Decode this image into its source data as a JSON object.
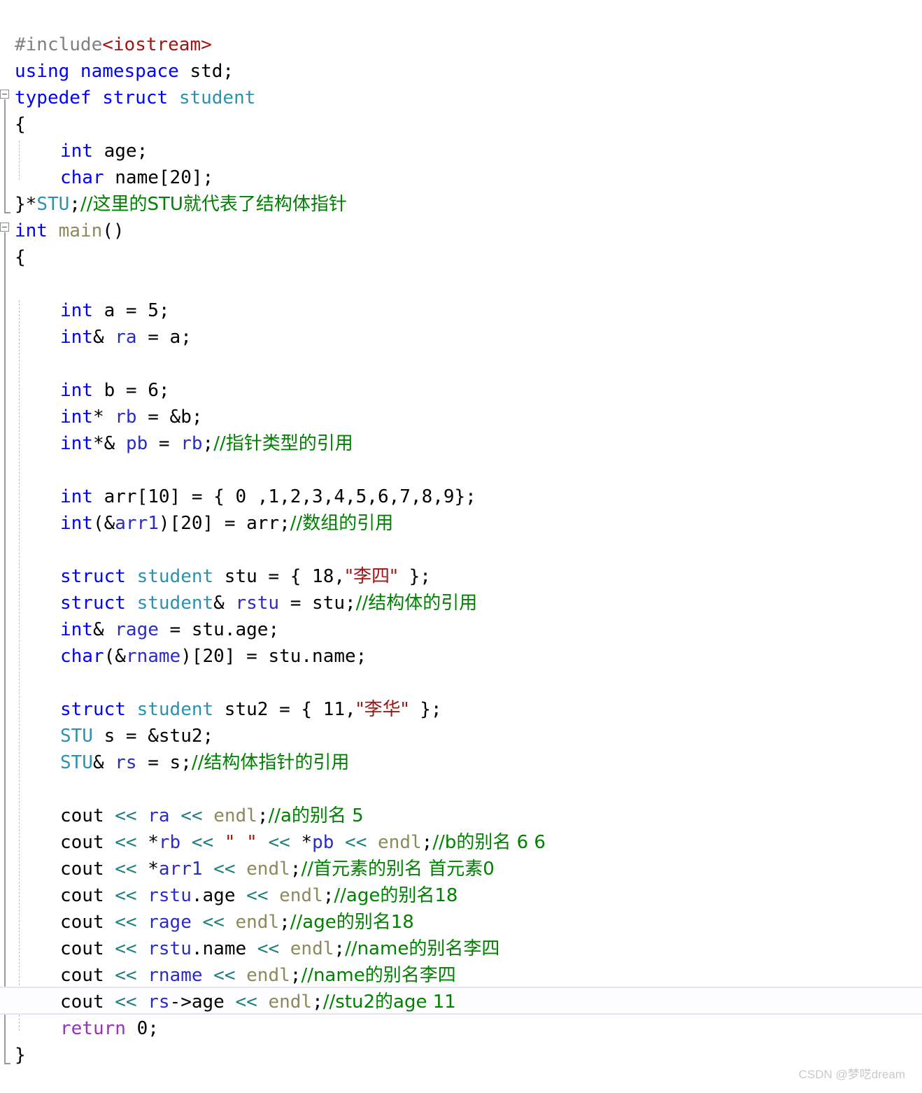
{
  "editor": {
    "language": "C++",
    "background": "#ffffff",
    "line_height": 38,
    "font_size": 26,
    "current_line_number": 35,
    "current_line_highlight_color": "#e4e4f2"
  },
  "palette": {
    "preprocessor": "#808080",
    "header": "#a31515",
    "keyword": "#0000ff",
    "user_type": "#2b91af",
    "identifier": "#000000",
    "variable": "#2b2bc8",
    "function": "#8c8a5a",
    "stream_operator": "#217f7f",
    "string": "#a31515",
    "comment": "#008000",
    "return_keyword": "#9b30c0",
    "fold_marker": "#8c8c8c",
    "indent_guide": "#bdbdbd",
    "scope_bar": "#9a9a9a"
  },
  "gutter": {
    "fold_markers": [
      {
        "name": "fold-typedef-struct-student",
        "state": "expanded",
        "glyph": "minus-square"
      },
      {
        "name": "fold-int-main",
        "state": "expanded",
        "glyph": "minus-square"
      }
    ]
  },
  "code": {
    "lines": [
      {
        "n": 1,
        "indent": 0,
        "segments": [
          {
            "t": "#include",
            "c": "pre"
          },
          {
            "t": "<iostream>",
            "c": "header"
          }
        ]
      },
      {
        "n": 2,
        "indent": 0,
        "segments": [
          {
            "t": "using namespace",
            "c": "kw"
          },
          {
            "t": " std;",
            "c": "plain"
          }
        ]
      },
      {
        "n": 3,
        "indent": 0,
        "segments": [
          {
            "t": "typedef struct",
            "c": "kw"
          },
          {
            "t": " ",
            "c": "plain"
          },
          {
            "t": "student",
            "c": "type"
          }
        ]
      },
      {
        "n": 4,
        "indent": 0,
        "segments": [
          {
            "t": "{",
            "c": "plain"
          }
        ]
      },
      {
        "n": 5,
        "indent": 1,
        "segments": [
          {
            "t": "int",
            "c": "kw"
          },
          {
            "t": " age;",
            "c": "plain"
          }
        ]
      },
      {
        "n": 6,
        "indent": 1,
        "segments": [
          {
            "t": "char",
            "c": "kw"
          },
          {
            "t": " name[20];",
            "c": "plain"
          }
        ]
      },
      {
        "n": 7,
        "indent": 0,
        "segments": [
          {
            "t": "}*",
            "c": "plain"
          },
          {
            "t": "STU",
            "c": "type"
          },
          {
            "t": ";",
            "c": "plain"
          },
          {
            "t": "//这里的STU就代表了结构体指针",
            "c": "cmt"
          }
        ]
      },
      {
        "n": 8,
        "indent": 0,
        "segments": [
          {
            "t": "int",
            "c": "kw"
          },
          {
            "t": " ",
            "c": "plain"
          },
          {
            "t": "main",
            "c": "fn"
          },
          {
            "t": "()",
            "c": "plain"
          }
        ]
      },
      {
        "n": 9,
        "indent": 0,
        "segments": [
          {
            "t": "{",
            "c": "plain"
          }
        ]
      },
      {
        "n": 10,
        "indent": 0,
        "segments": []
      },
      {
        "n": 11,
        "indent": 1,
        "segments": [
          {
            "t": "int",
            "c": "kw"
          },
          {
            "t": " a = ",
            "c": "plain"
          },
          {
            "t": "5",
            "c": "num"
          },
          {
            "t": ";",
            "c": "plain"
          }
        ]
      },
      {
        "n": 12,
        "indent": 1,
        "segments": [
          {
            "t": "int",
            "c": "kw"
          },
          {
            "t": "& ",
            "c": "plain"
          },
          {
            "t": "ra",
            "c": "var"
          },
          {
            "t": " = a;",
            "c": "plain"
          }
        ]
      },
      {
        "n": 13,
        "indent": 0,
        "segments": []
      },
      {
        "n": 14,
        "indent": 1,
        "segments": [
          {
            "t": "int",
            "c": "kw"
          },
          {
            "t": " b = ",
            "c": "plain"
          },
          {
            "t": "6",
            "c": "num"
          },
          {
            "t": ";",
            "c": "plain"
          }
        ]
      },
      {
        "n": 15,
        "indent": 1,
        "segments": [
          {
            "t": "int",
            "c": "kw"
          },
          {
            "t": "* ",
            "c": "plain"
          },
          {
            "t": "rb",
            "c": "var"
          },
          {
            "t": " = &b;",
            "c": "plain"
          }
        ]
      },
      {
        "n": 16,
        "indent": 1,
        "segments": [
          {
            "t": "int",
            "c": "kw"
          },
          {
            "t": "*& ",
            "c": "plain"
          },
          {
            "t": "pb",
            "c": "var"
          },
          {
            "t": " = ",
            "c": "plain"
          },
          {
            "t": "rb",
            "c": "var"
          },
          {
            "t": ";",
            "c": "plain"
          },
          {
            "t": "//指针类型的引用",
            "c": "cmt"
          }
        ]
      },
      {
        "n": 17,
        "indent": 0,
        "segments": []
      },
      {
        "n": 18,
        "indent": 1,
        "segments": [
          {
            "t": "int",
            "c": "kw"
          },
          {
            "t": " arr[10] = { 0 ,1,2,3,4,5,6,7,8,9};",
            "c": "plain"
          }
        ]
      },
      {
        "n": 19,
        "indent": 1,
        "segments": [
          {
            "t": "int",
            "c": "kw"
          },
          {
            "t": "(&",
            "c": "plain"
          },
          {
            "t": "arr1",
            "c": "var"
          },
          {
            "t": ")[20]",
            "c": "plain"
          },
          {
            "t": " = arr;",
            "c": "plain"
          },
          {
            "t": "//数组的引用",
            "c": "cmt"
          }
        ]
      },
      {
        "n": 20,
        "indent": 0,
        "segments": []
      },
      {
        "n": 21,
        "indent": 1,
        "segments": [
          {
            "t": "struct",
            "c": "kw"
          },
          {
            "t": " ",
            "c": "plain"
          },
          {
            "t": "student",
            "c": "type"
          },
          {
            "t": " stu = { ",
            "c": "plain"
          },
          {
            "t": "18",
            "c": "num"
          },
          {
            "t": ",",
            "c": "plain"
          },
          {
            "t": "\"李四\"",
            "c": "str"
          },
          {
            "t": " };",
            "c": "plain"
          }
        ]
      },
      {
        "n": 22,
        "indent": 1,
        "segments": [
          {
            "t": "struct",
            "c": "kw"
          },
          {
            "t": " ",
            "c": "plain"
          },
          {
            "t": "student",
            "c": "type"
          },
          {
            "t": "& ",
            "c": "plain"
          },
          {
            "t": "rstu",
            "c": "var"
          },
          {
            "t": " = stu;",
            "c": "plain"
          },
          {
            "t": "//结构体的引用",
            "c": "cmt"
          }
        ]
      },
      {
        "n": 23,
        "indent": 1,
        "segments": [
          {
            "t": "int",
            "c": "kw"
          },
          {
            "t": "& ",
            "c": "plain"
          },
          {
            "t": "rage",
            "c": "var"
          },
          {
            "t": " = stu.age;",
            "c": "plain"
          }
        ]
      },
      {
        "n": 24,
        "indent": 1,
        "segments": [
          {
            "t": "char",
            "c": "kw"
          },
          {
            "t": "(&",
            "c": "plain"
          },
          {
            "t": "rname",
            "c": "var"
          },
          {
            "t": ")[20] = stu.name;",
            "c": "plain"
          }
        ]
      },
      {
        "n": 25,
        "indent": 0,
        "segments": []
      },
      {
        "n": 26,
        "indent": 1,
        "segments": [
          {
            "t": "struct",
            "c": "kw"
          },
          {
            "t": " ",
            "c": "plain"
          },
          {
            "t": "student",
            "c": "type"
          },
          {
            "t": " stu2 = { ",
            "c": "plain"
          },
          {
            "t": "11",
            "c": "num"
          },
          {
            "t": ",",
            "c": "plain"
          },
          {
            "t": "\"李华\"",
            "c": "str"
          },
          {
            "t": " };",
            "c": "plain"
          }
        ]
      },
      {
        "n": 27,
        "indent": 1,
        "segments": [
          {
            "t": "STU",
            "c": "type"
          },
          {
            "t": " s = &stu2;",
            "c": "plain"
          }
        ]
      },
      {
        "n": 28,
        "indent": 1,
        "segments": [
          {
            "t": "STU",
            "c": "type"
          },
          {
            "t": "& ",
            "c": "plain"
          },
          {
            "t": "rs",
            "c": "var"
          },
          {
            "t": " = s;",
            "c": "plain"
          },
          {
            "t": "//结构体指针的引用",
            "c": "cmt"
          }
        ]
      },
      {
        "n": 29,
        "indent": 0,
        "segments": []
      },
      {
        "n": 30,
        "indent": 1,
        "segments": [
          {
            "t": "cout",
            "c": "plain"
          },
          {
            "t": " << ",
            "c": "op"
          },
          {
            "t": "ra",
            "c": "var"
          },
          {
            "t": " << ",
            "c": "op"
          },
          {
            "t": "endl",
            "c": "fn"
          },
          {
            "t": ";",
            "c": "plain"
          },
          {
            "t": "//a的别名 5",
            "c": "cmt"
          }
        ]
      },
      {
        "n": 31,
        "indent": 1,
        "segments": [
          {
            "t": "cout",
            "c": "plain"
          },
          {
            "t": " << ",
            "c": "op"
          },
          {
            "t": "*",
            "c": "plain"
          },
          {
            "t": "rb",
            "c": "var"
          },
          {
            "t": " << ",
            "c": "op"
          },
          {
            "t": "\" \"",
            "c": "str"
          },
          {
            "t": " << ",
            "c": "op"
          },
          {
            "t": "*",
            "c": "plain"
          },
          {
            "t": "pb",
            "c": "var"
          },
          {
            "t": " << ",
            "c": "op"
          },
          {
            "t": "endl",
            "c": "fn"
          },
          {
            "t": ";",
            "c": "plain"
          },
          {
            "t": "//b的别名 6 6",
            "c": "cmt"
          }
        ]
      },
      {
        "n": 32,
        "indent": 1,
        "segments": [
          {
            "t": "cout",
            "c": "plain"
          },
          {
            "t": " << ",
            "c": "op"
          },
          {
            "t": "*",
            "c": "plain"
          },
          {
            "t": "arr1",
            "c": "var"
          },
          {
            "t": " << ",
            "c": "op"
          },
          {
            "t": "endl",
            "c": "fn"
          },
          {
            "t": ";",
            "c": "plain"
          },
          {
            "t": "//首元素的别名 首元素0",
            "c": "cmt"
          }
        ]
      },
      {
        "n": 33,
        "indent": 1,
        "segments": [
          {
            "t": "cout",
            "c": "plain"
          },
          {
            "t": " << ",
            "c": "op"
          },
          {
            "t": "rstu",
            "c": "var"
          },
          {
            "t": ".age",
            " c": "plain",
            "c": "plain"
          },
          {
            "t": " << ",
            "c": "op"
          },
          {
            "t": "endl",
            "c": "fn"
          },
          {
            "t": ";",
            "c": "plain"
          },
          {
            "t": "//age的别名18",
            "c": "cmt"
          }
        ]
      },
      {
        "n": 34,
        "indent": 1,
        "segments": [
          {
            "t": "cout",
            "c": "plain"
          },
          {
            "t": " << ",
            "c": "op"
          },
          {
            "t": "rage",
            "c": "var"
          },
          {
            "t": " << ",
            "c": "op"
          },
          {
            "t": "endl",
            "c": "fn"
          },
          {
            "t": ";",
            "c": "plain"
          },
          {
            "t": "//age的别名18",
            "c": "cmt"
          }
        ]
      },
      {
        "n": 35,
        "indent": 1,
        "segments": [
          {
            "t": "cout",
            "c": "plain"
          },
          {
            "t": " << ",
            "c": "op"
          },
          {
            "t": "rstu",
            "c": "var"
          },
          {
            "t": ".name",
            "c": "plain"
          },
          {
            "t": " << ",
            "c": "op"
          },
          {
            "t": "endl",
            "c": "fn"
          },
          {
            "t": ";",
            "c": "plain"
          },
          {
            "t": "//name的别名李四",
            "c": "cmt"
          }
        ]
      },
      {
        "n": 36,
        "indent": 1,
        "segments": [
          {
            "t": "cout",
            "c": "plain"
          },
          {
            "t": " << ",
            "c": "op"
          },
          {
            "t": "rname",
            "c": "var"
          },
          {
            "t": " << ",
            "c": "op"
          },
          {
            "t": "endl",
            "c": "fn"
          },
          {
            "t": ";",
            "c": "plain"
          },
          {
            "t": "//name的别名李四",
            "c": "cmt"
          }
        ]
      },
      {
        "n": 37,
        "indent": 1,
        "current": true,
        "segments": [
          {
            "t": "cout",
            "c": "plain"
          },
          {
            "t": " << ",
            "c": "op"
          },
          {
            "t": "rs",
            "c": "var"
          },
          {
            "t": "->age",
            "c": "plain"
          },
          {
            "t": " << ",
            "c": "op"
          },
          {
            "t": "endl",
            "c": "fn"
          },
          {
            "t": ";",
            "c": "plain"
          },
          {
            "t": "//stu2的age 11",
            "c": "cmt"
          }
        ]
      },
      {
        "n": 38,
        "indent": 1,
        "segments": [
          {
            "t": "return",
            "c": "ret"
          },
          {
            "t": " ",
            "c": "plain"
          },
          {
            "t": "0",
            "c": "num"
          },
          {
            "t": ";",
            "c": "plain"
          }
        ]
      },
      {
        "n": 39,
        "indent": 0,
        "segments": [
          {
            "t": "}",
            "c": "plain"
          }
        ]
      }
    ]
  },
  "watermark": {
    "text": "CSDN @梦呓dream"
  }
}
